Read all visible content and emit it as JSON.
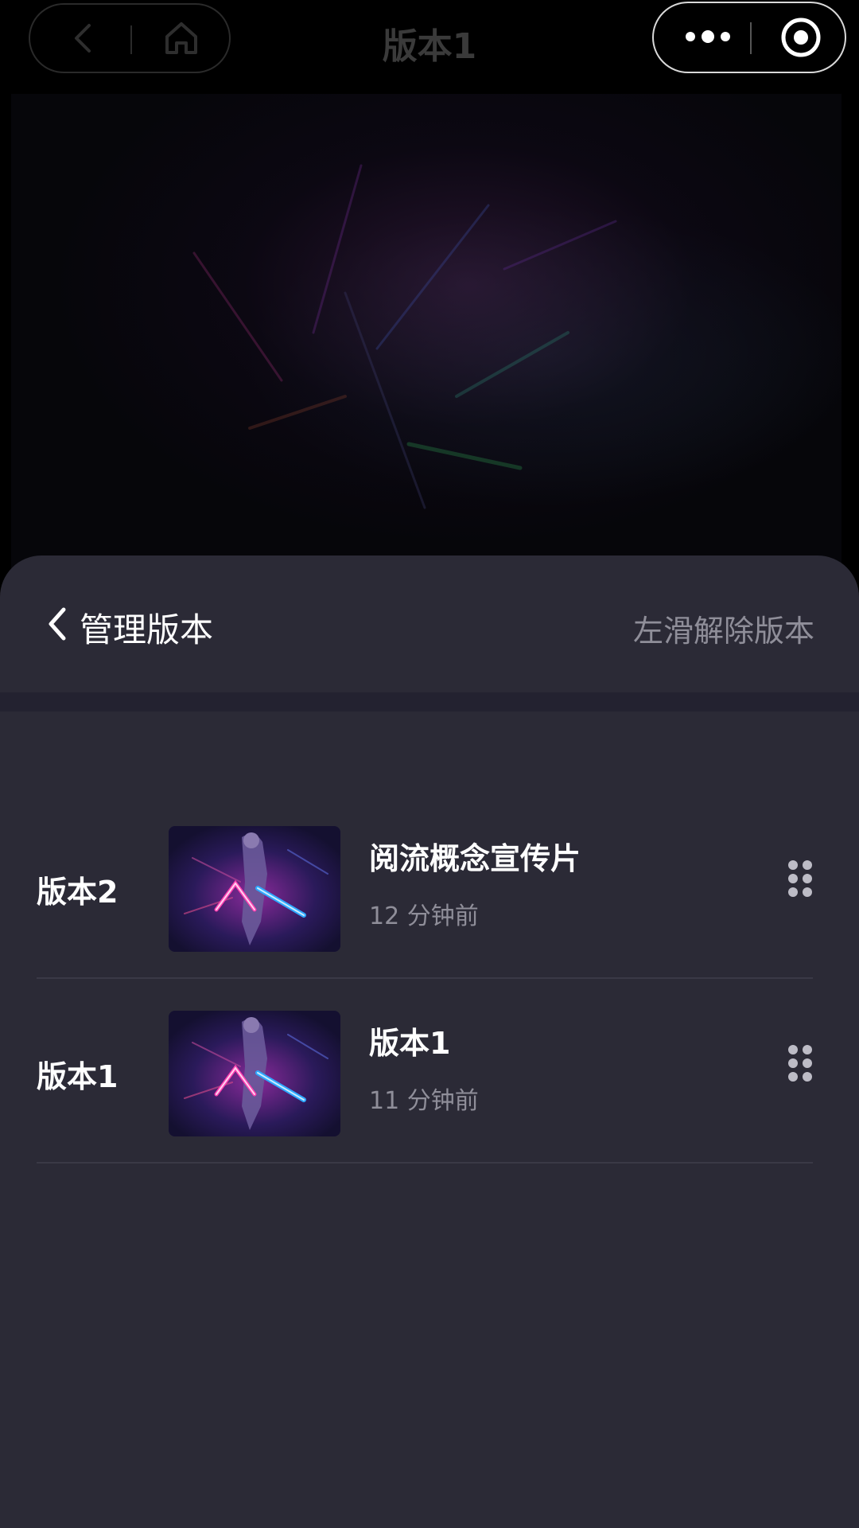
{
  "nav": {
    "title": "版本1"
  },
  "sheet": {
    "title": "管理版本",
    "swipe_hint": "左滑解除版本"
  },
  "versions": [
    {
      "label": "版本2",
      "title": "阅流概念宣传片",
      "time": "12 分钟前"
    },
    {
      "label": "版本1",
      "title": "版本1",
      "time": "11 分钟前"
    }
  ],
  "colors": {
    "sheet_bg": "#2b2a36",
    "muted_text": "#8f8e99",
    "neon_pink": "#ff3fb0",
    "neon_blue": "#2ea8ff"
  },
  "icons": [
    "back-icon",
    "home-icon",
    "more-icon",
    "target-icon",
    "chevron-left-icon",
    "drag-handle-icon"
  ]
}
